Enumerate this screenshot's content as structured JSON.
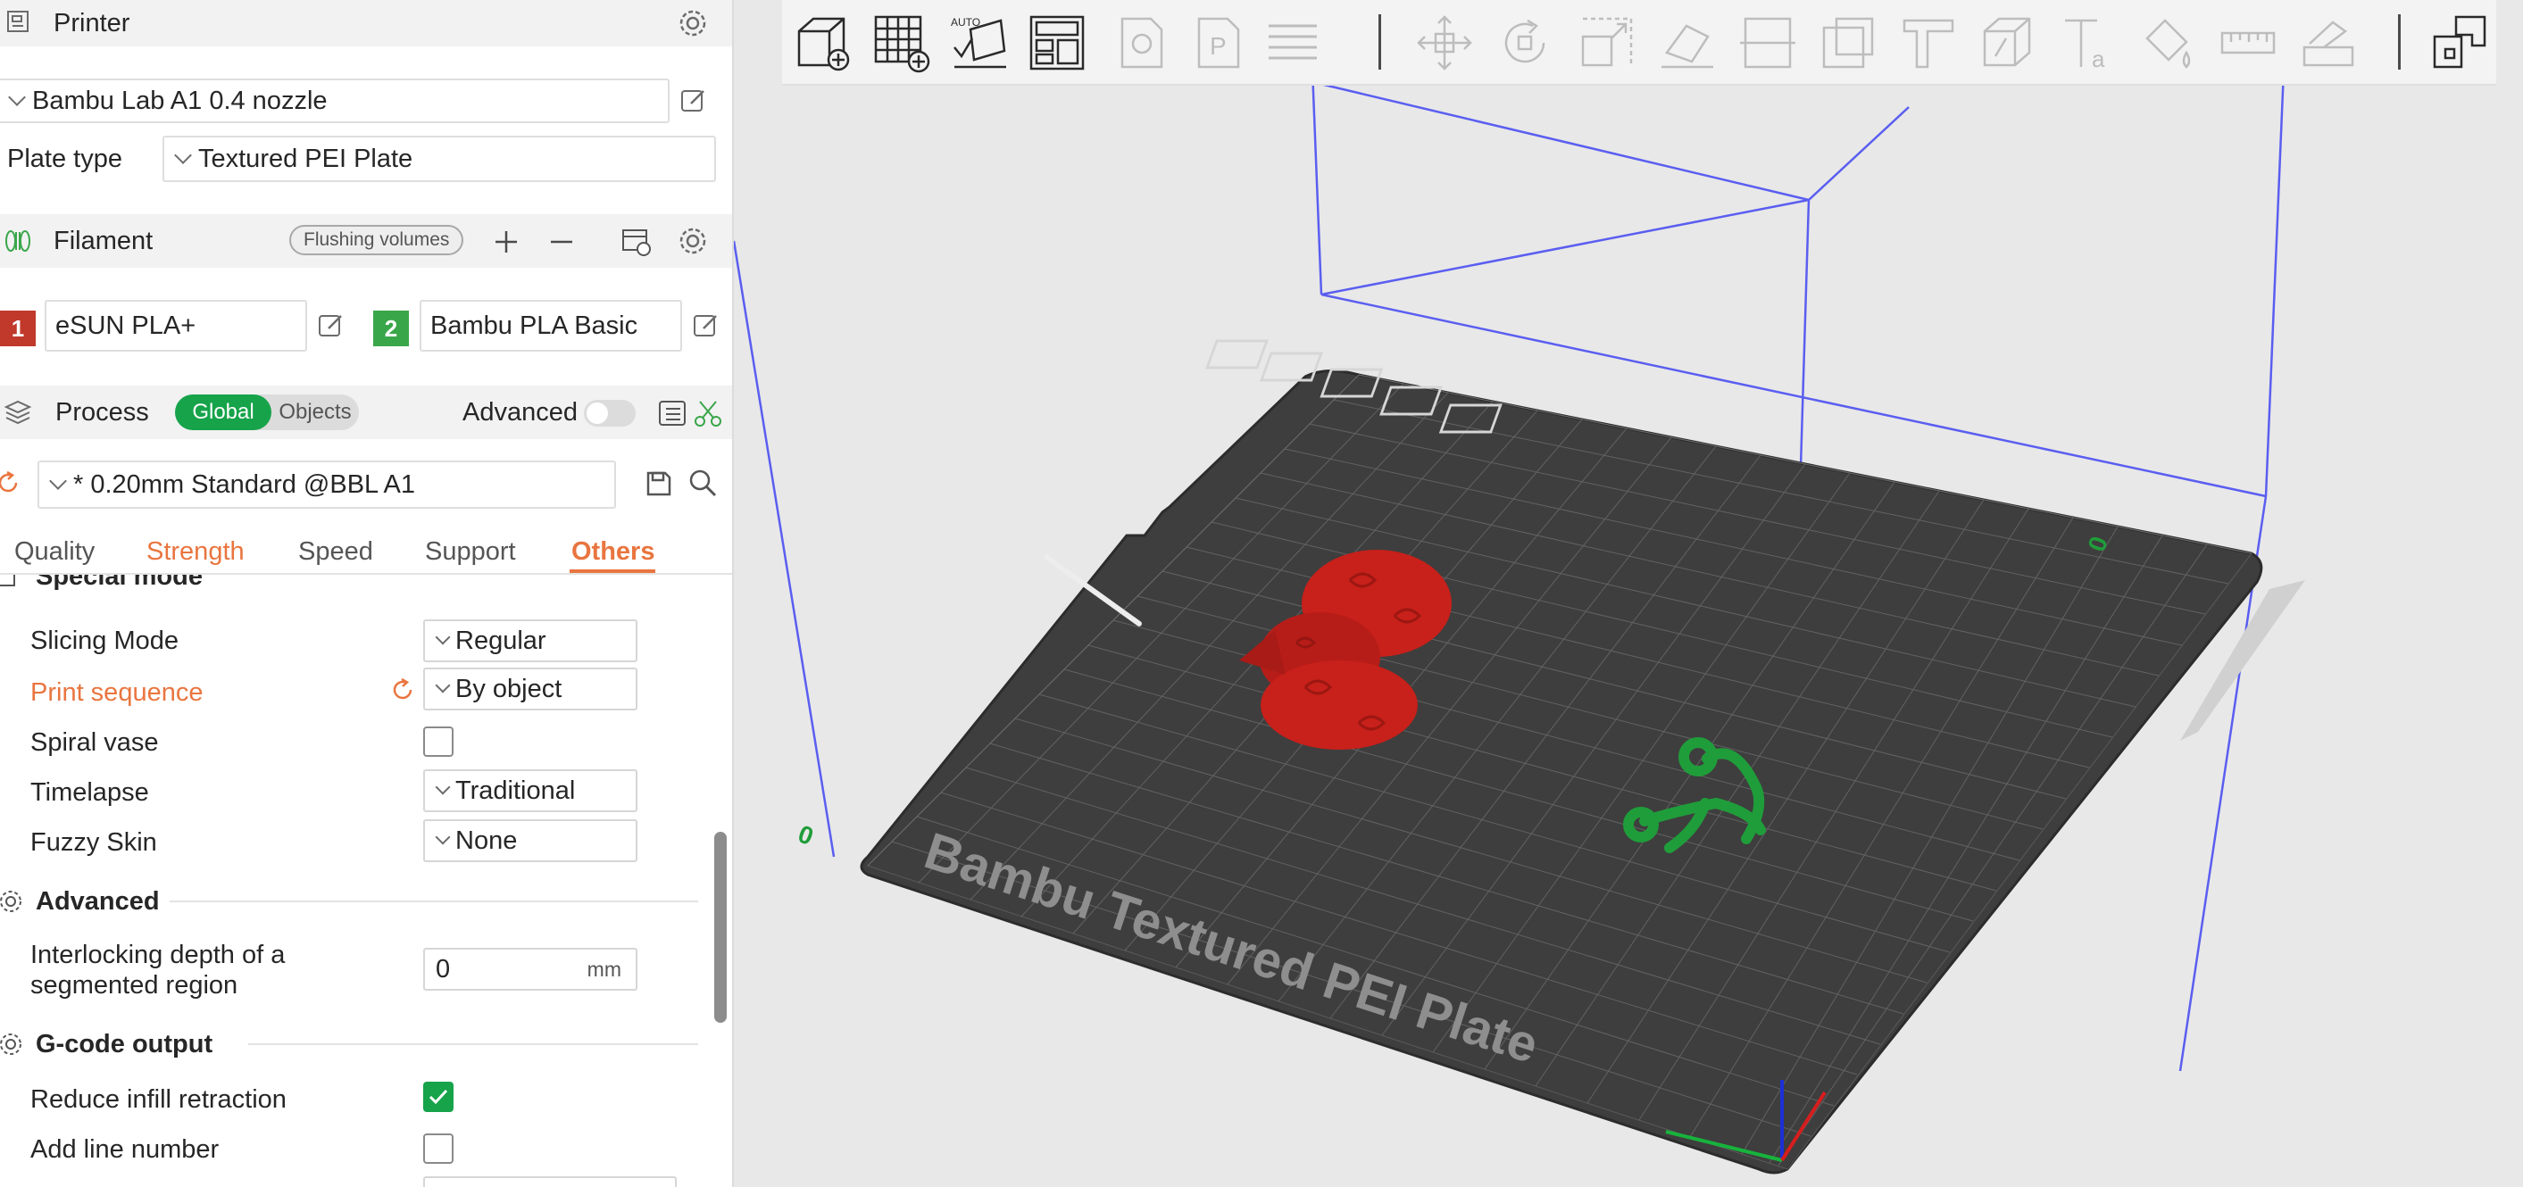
{
  "printer": {
    "section_title": "Printer",
    "preset": "Bambu Lab A1 0.4 nozzle",
    "plate_type_label": "Plate type",
    "plate_type_value": "Textured PEI Plate"
  },
  "filament": {
    "section_title": "Filament",
    "flushing_button": "Flushing volumes",
    "slots": [
      {
        "index": "1",
        "name": "eSUN PLA+",
        "color": "#c0392b"
      },
      {
        "index": "2",
        "name": "Bambu PLA Basic",
        "color": "#3aa64a"
      }
    ]
  },
  "process": {
    "section_title": "Process",
    "toggle_global": "Global",
    "toggle_objects": "Objects",
    "advanced_label": "Advanced",
    "preset": "* 0.20mm Standard @BBL A1",
    "tabs": [
      "Quality",
      "Strength",
      "Speed",
      "Support",
      "Others"
    ],
    "active_tab": "Others"
  },
  "settings": {
    "special_mode_title": "Special mode",
    "slicing_mode_label": "Slicing Mode",
    "slicing_mode_value": "Regular",
    "print_sequence_label": "Print sequence",
    "print_sequence_value": "By object",
    "spiral_vase_label": "Spiral vase",
    "spiral_vase_checked": false,
    "timelapse_label": "Timelapse",
    "timelapse_value": "Traditional",
    "fuzzy_skin_label": "Fuzzy Skin",
    "fuzzy_skin_value": "None",
    "advanced_title": "Advanced",
    "interlocking_label_line1": "Interlocking depth of a",
    "interlocking_label_line2": "segmented region",
    "interlocking_value": "0",
    "interlocking_unit": "mm",
    "gcode_title": "G-code output",
    "reduce_infill_label": "Reduce infill retraction",
    "reduce_infill_checked": true,
    "add_line_number_label": "Add line number",
    "add_line_number_checked": false
  },
  "viewport": {
    "plate_label": "Bambu Textured PEI Plate",
    "axis_label_left": "0",
    "axis_label_right": "0",
    "accent_blue": "#5a5ef0",
    "object_red": "#c8201a",
    "object_green": "#1f9d3a"
  },
  "colors": {
    "accent_green": "#16a34a",
    "accent_orange": "#e9753f"
  }
}
